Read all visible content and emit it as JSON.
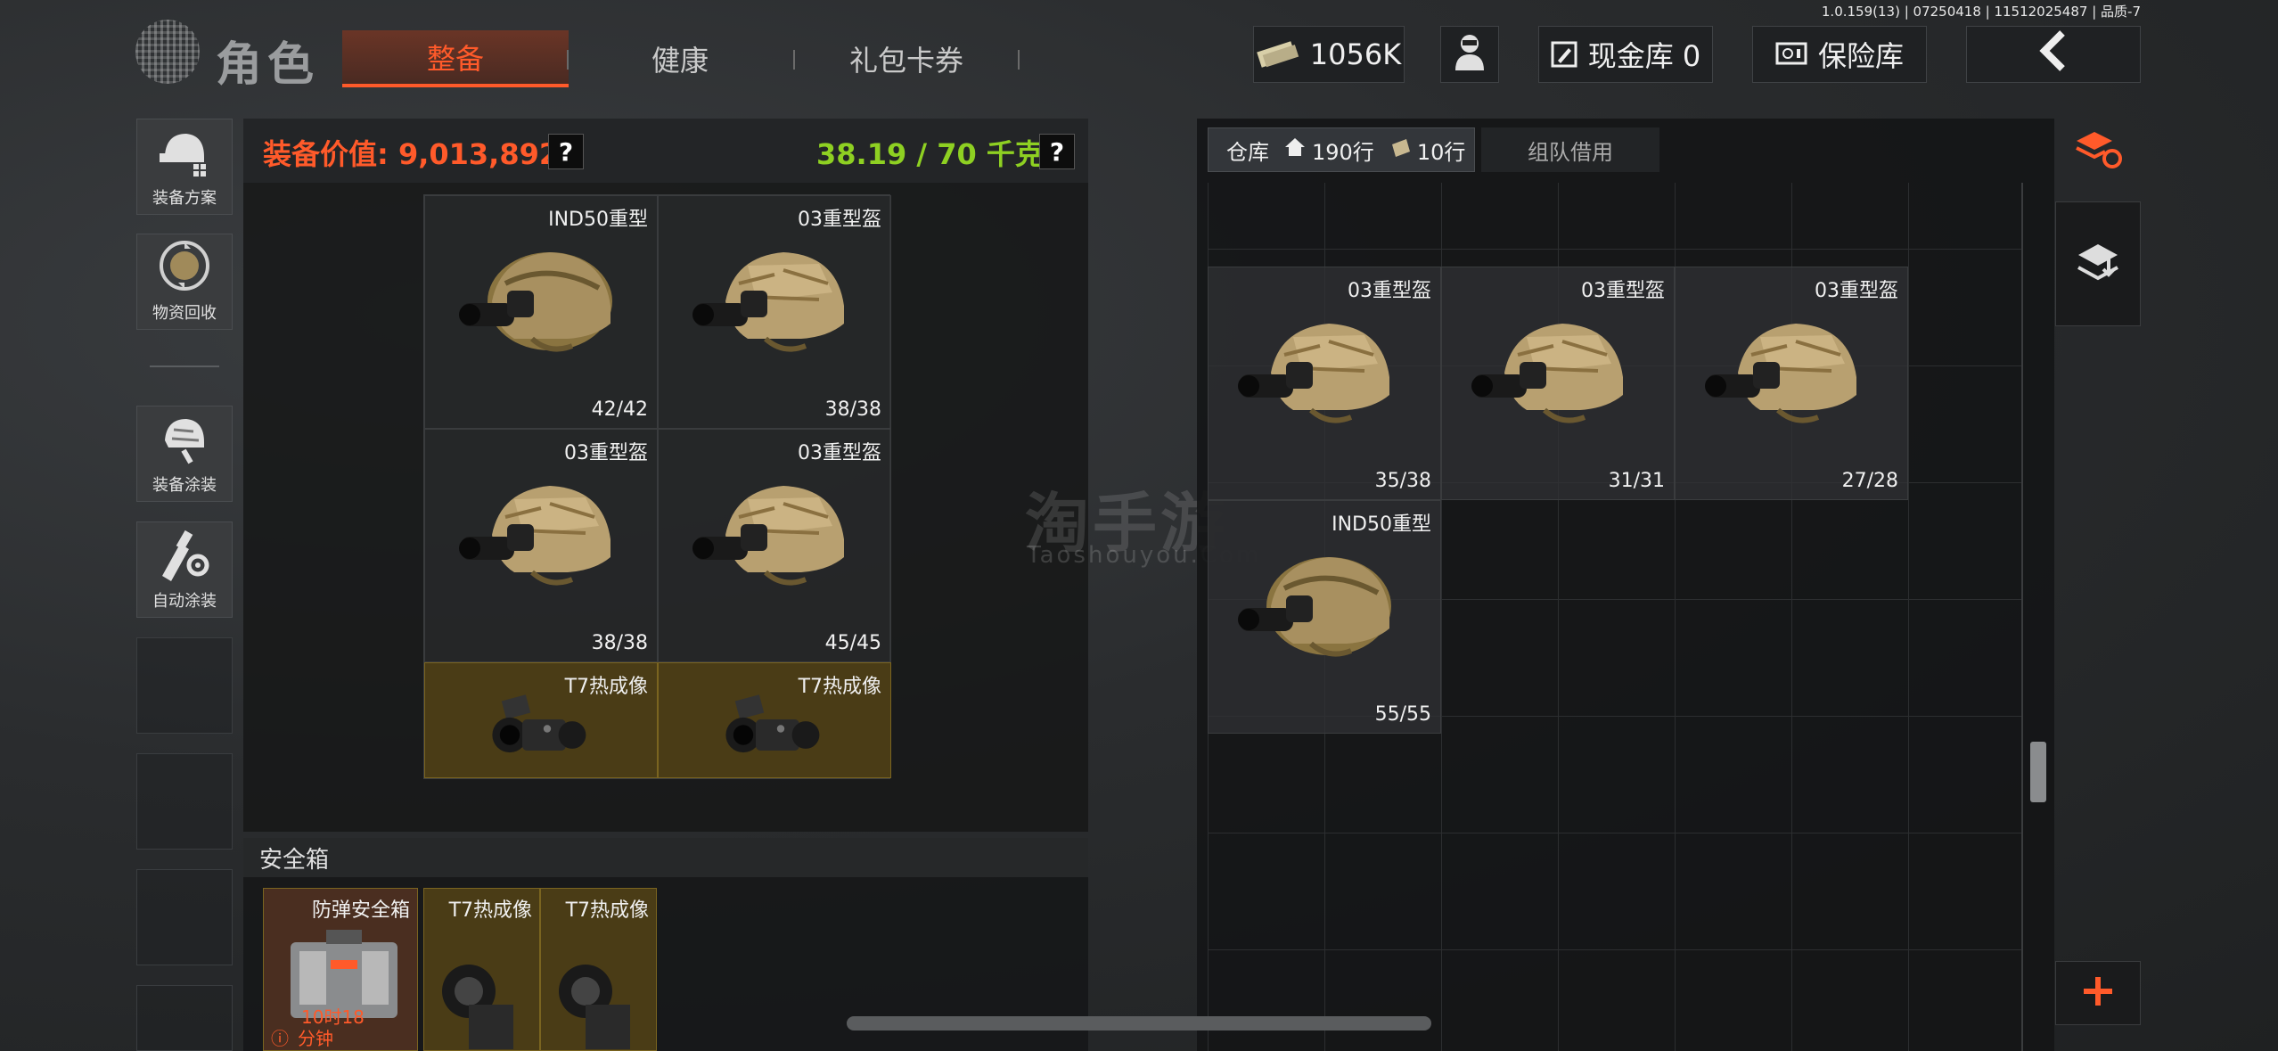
{
  "version": "1.0.159(13) | 07250418 | 11512025487 | 品质-7",
  "header": {
    "title": "角色",
    "tabs": [
      {
        "label": "整备",
        "active": true
      },
      {
        "label": "健康",
        "active": false
      },
      {
        "label": "礼包卡券",
        "active": false
      }
    ],
    "currency": "1056K",
    "cash_vault": "现金库 0",
    "safe_vault": "保险库"
  },
  "sidebar": {
    "items": [
      {
        "label": "装备方案",
        "icon": "helmet-plan-icon"
      },
      {
        "label": "物资回收",
        "icon": "recycle-icon"
      },
      {
        "label": "装备涂装",
        "icon": "helmet-paint-icon"
      },
      {
        "label": "自动涂装",
        "icon": "brush-gear-icon"
      }
    ]
  },
  "loadout": {
    "value_label": "装备价值: 9,013,892",
    "weight_label": "38.19 / 70 千克",
    "help": "?",
    "items": [
      {
        "name": "IND50重型",
        "durability": "42/42",
        "type": "helmet"
      },
      {
        "name": "03重型盔",
        "durability": "38/38",
        "type": "helmet"
      },
      {
        "name": "03重型盔",
        "durability": "38/38",
        "type": "helmet"
      },
      {
        "name": "03重型盔",
        "durability": "45/45",
        "type": "helmet"
      },
      {
        "name": "T7热成像",
        "durability": "",
        "type": "thermal"
      },
      {
        "name": "T7热成像",
        "durability": "",
        "type": "thermal"
      }
    ]
  },
  "safe_box": {
    "title": "安全箱",
    "items": [
      {
        "name": "防弹安全箱",
        "timer": "10时18",
        "timer2": "分钟"
      },
      {
        "name": "T7热成像"
      },
      {
        "name": "T7热成像"
      }
    ]
  },
  "warehouse": {
    "tab_label": "仓库",
    "rows_a": "190行",
    "rows_b": "10行",
    "team_tab": "组队借用",
    "items": [
      {
        "name": "03重型盔",
        "durability": "35/38"
      },
      {
        "name": "03重型盔",
        "durability": "31/31"
      },
      {
        "name": "03重型盔",
        "durability": "27/28"
      },
      {
        "name": "IND50重型",
        "durability": "55/55"
      }
    ]
  },
  "watermark": {
    "main": "淘手游",
    "sub": "Taoshouyou.Com"
  },
  "colors": {
    "accent": "#ff5a2a",
    "weight": "#8ed022",
    "gold_cell": "#4a3c16"
  }
}
